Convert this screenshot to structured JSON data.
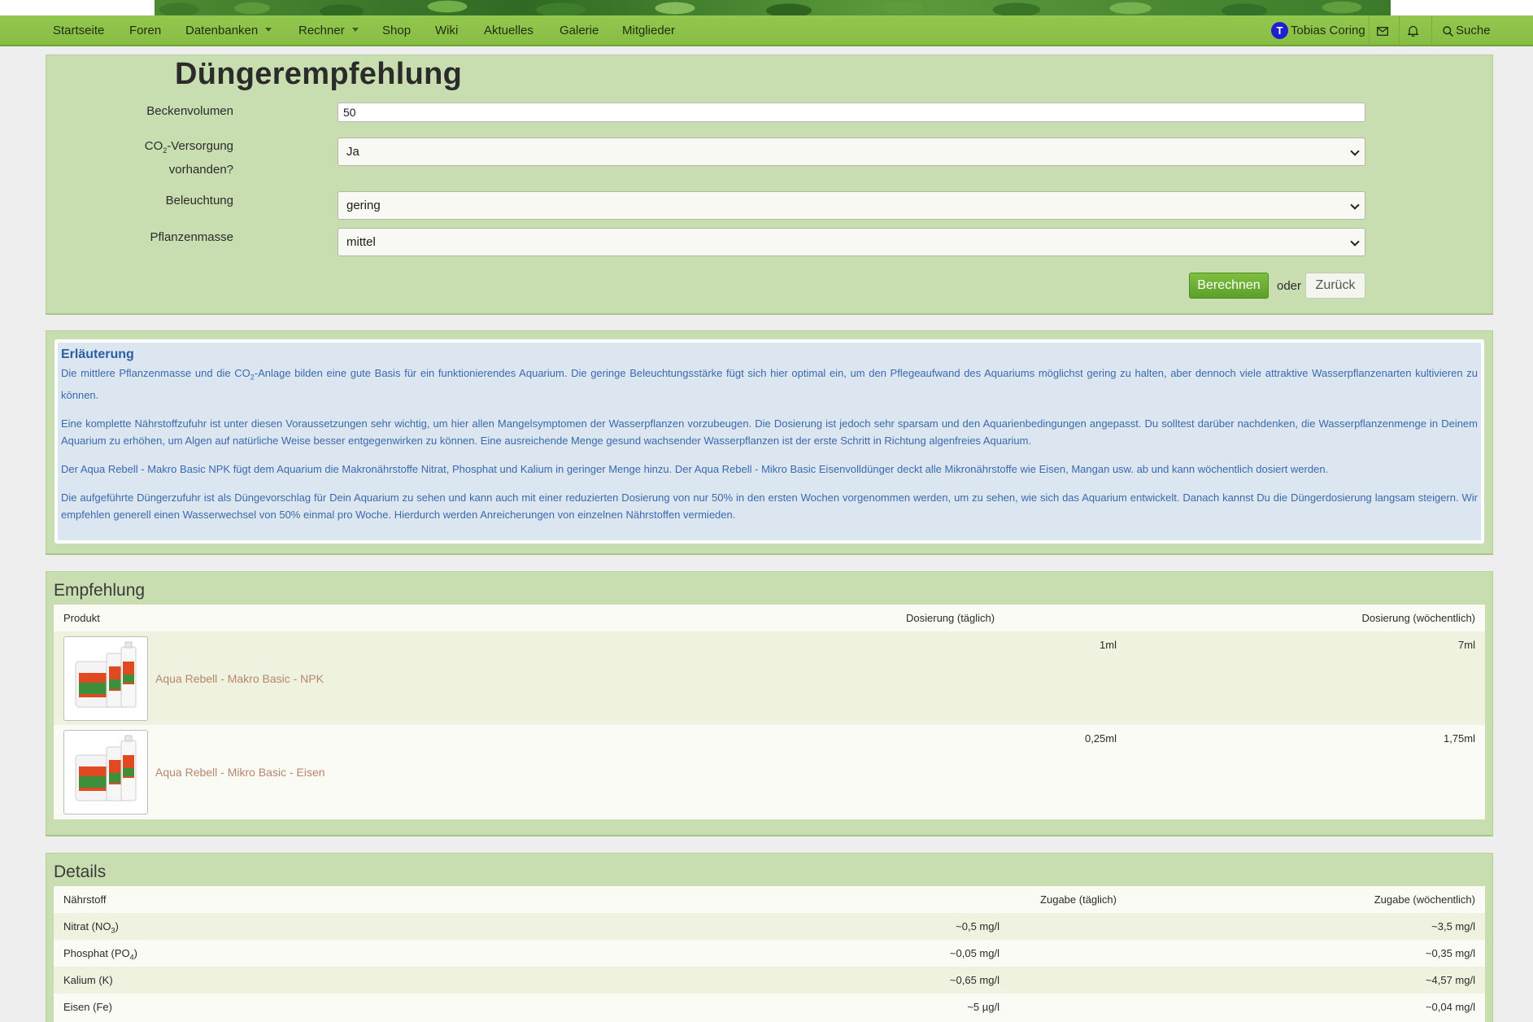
{
  "nav": {
    "items": [
      "Startseite",
      "Foren",
      "Datenbanken",
      "Rechner",
      "Shop",
      "Wiki",
      "Aktuelles",
      "Galerie",
      "Mitglieder"
    ],
    "user": {
      "initial": "T",
      "name": "Tobias Coring",
      "avatar_color": "#1f1fcf"
    },
    "search_label": "Suche"
  },
  "form": {
    "title": "Düngerempfehlung",
    "volume": {
      "label": "Beckenvolumen",
      "value": "50"
    },
    "co2": {
      "label_prefix": "CO",
      "label_sub": "2",
      "label_suffix": "-Versorgung",
      "label_line2": "vorhanden?",
      "value": "Ja"
    },
    "light": {
      "label": "Beleuchtung",
      "value": "gering"
    },
    "mass": {
      "label": "Pflanzenmasse",
      "value": "mittel"
    },
    "calc_label": "Berechnen",
    "or_label": "oder",
    "back_label": "Zurück"
  },
  "explanation": {
    "title": "Erläuterung",
    "p1a": "Die mittlere Pflanzenmasse und die CO",
    "p1sub": "2",
    "p1b": "-Anlage bilden eine gute Basis für ein funktionierendes Aquarium. Die geringe Beleuchtungsstärke fügt sich hier optimal ein, um den Pflegeaufwand des Aquariums möglichst gering zu halten, aber dennoch viele attraktive Wasserpflanzenarten kultivieren zu können.",
    "p2": "Eine komplette Nährstoffzufuhr ist unter diesen Voraussetzungen sehr wichtig, um hier allen Mangelsymptomen der Wasserpflanzen vorzubeugen. Die Dosierung ist jedoch sehr sparsam und den Aquarienbedingungen angepasst. Du solltest darüber nachdenken, die Wasserpflanzenmenge in Deinem Aquarium zu erhöhen, um Algen auf natürliche Weise besser entgegenwirken zu können. Eine ausreichende Menge gesund wachsender Wasserpflanzen ist der erste Schritt in Richtung algenfreies Aquarium.",
    "p3": "Der Aqua Rebell - Makro Basic NPK fügt dem Aquarium die Makronährstoffe Nitrat, Phosphat und Kalium in geringer Menge hinzu. Der Aqua Rebell - Mikro Basic Eisenvolldünger deckt alle Mikronährstoffe wie Eisen, Mangan usw. ab und kann wöchentlich dosiert werden.",
    "p4": "Die aufgeführte Düngerzufuhr ist als Düngevorschlag für Dein Aquarium zu sehen und kann auch mit einer reduzierten Dosierung von nur 50% in den ersten Wochen vorgenommen werden, um zu sehen, wie sich das Aquarium entwickelt. Danach kannst Du die Düngerdosierung langsam steigern. Wir empfehlen generell einen Wasserwechsel von 50% einmal pro Woche. Hierdurch werden Anreicherungen von einzelnen Nährstoffen vermieden."
  },
  "recommendation": {
    "title": "Empfehlung",
    "headers": {
      "product": "Produkt",
      "daily": "Dosierung (täglich)",
      "weekly": "Dosierung (wöchentlich)"
    },
    "rows": [
      {
        "product": "Aqua Rebell - Makro Basic - NPK",
        "daily": "1ml",
        "weekly": "7ml",
        "bottle_color": "#d9532a"
      },
      {
        "product": "Aqua Rebell - Mikro Basic - Eisen",
        "daily": "0,25ml",
        "weekly": "1,75ml",
        "bottle_color": "#d9532a"
      }
    ]
  },
  "details": {
    "title": "Details",
    "headers": {
      "nutrient": "Nährstoff",
      "daily": "Zugabe (täglich)",
      "weekly": "Zugabe (wöchentlich)"
    },
    "rows": [
      {
        "name": "Nitrat (NO",
        "sub": "3",
        "close": ")",
        "daily": "~0,5 mg/l",
        "weekly": "~3,5 mg/l"
      },
      {
        "name": "Phosphat (PO",
        "sub": "4",
        "close": ")",
        "daily": "~0,05 mg/l",
        "weekly": "~0,35 mg/l"
      },
      {
        "name": "Kalium (K)",
        "sub": "",
        "close": "",
        "daily": "~0,65 mg/l",
        "weekly": "~4,57 mg/l"
      },
      {
        "name": "Eisen (Fe)",
        "sub": "",
        "close": "",
        "daily": "~5 µg/l",
        "weekly": "~0,04 mg/l"
      }
    ]
  },
  "colors": {
    "nav_bg": "#8bc34a",
    "panel_bg": "#c9deb0",
    "explanation_bg": "#dce6f0",
    "explanation_text": "#3a6aad",
    "product_link": "#b5876a",
    "primary_button": "#6aad33"
  }
}
